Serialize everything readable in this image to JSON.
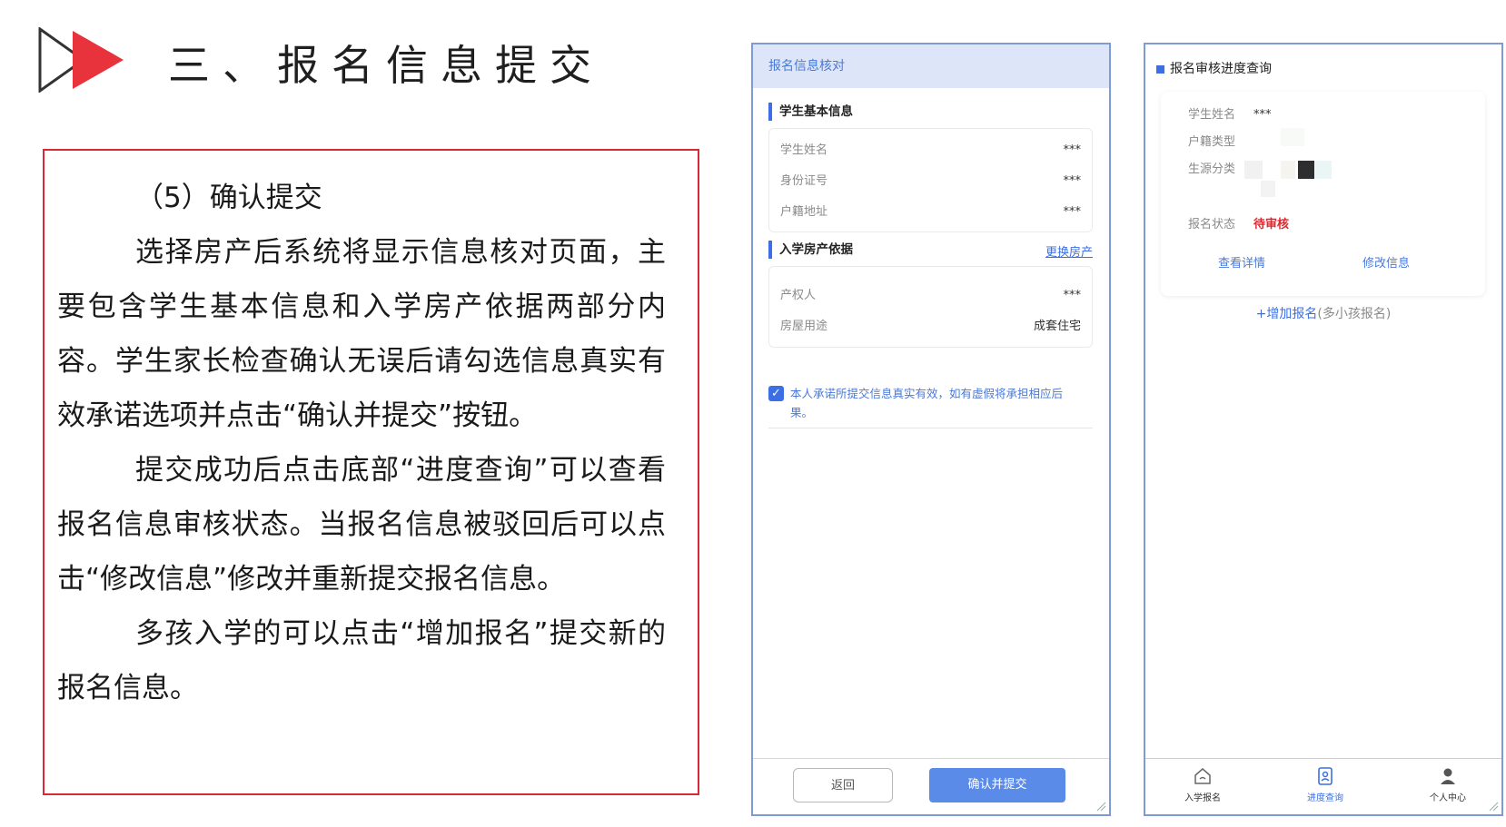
{
  "title": {
    "text": "三、报名信息提交"
  },
  "instructions": {
    "step": "（5）确认提交",
    "paragraphs": [
      "选择房产后系统将显示信息核对页面，主要包含学生基本信息和入学房产依据两部分内容。学生家长检查确认无误后请勾选信息真实有效承诺选项并点击“确认并提交”按钮。",
      "提交成功后点击底部“进度查询”可以查看报名信息审核状态。当报名信息被驳回后可以点击“修改信息”修改并重新提交报名信息。",
      "多孩入学的可以点击“增加报名”提交新的报名信息。"
    ]
  },
  "verify_screen": {
    "header": "报名信息核对",
    "student_section": {
      "title": "学生基本信息",
      "rows": [
        {
          "label": "学生姓名",
          "value": "***"
        },
        {
          "label": "身份证号",
          "value": "***"
        },
        {
          "label": "户籍地址",
          "value": "***"
        }
      ]
    },
    "property_section": {
      "title": "入学房产依据",
      "change_link": "更换房产",
      "rows": [
        {
          "label": "产权人",
          "value": "***"
        },
        {
          "label": "房屋用途",
          "value": "成套住宅"
        }
      ]
    },
    "pledge": {
      "checked": true,
      "text": "本人承诺所提交信息真实有效，如有虚假将承担相应后果。"
    },
    "back_button": "返回",
    "submit_button": "确认并提交"
  },
  "progress_screen": {
    "header": "报名审核进度查询",
    "fields": [
      {
        "label": "学生姓名",
        "value": "***"
      },
      {
        "label": "户籍类型",
        "value": ""
      },
      {
        "label": "生源分类",
        "value": ""
      },
      {
        "label": "报名状态",
        "value": "待审核"
      }
    ],
    "view_details": "查看详情",
    "modify_info": "修改信息",
    "add_registration": "+增加报名",
    "add_registration_note": "(多小孩报名)",
    "nav": [
      {
        "label": "入学报名",
        "icon": "home-icon",
        "active": false
      },
      {
        "label": "进度查询",
        "icon": "progress-doc-icon",
        "active": true
      },
      {
        "label": "个人中心",
        "icon": "user-icon",
        "active": false
      }
    ]
  },
  "colors": {
    "accent": "#3b6fe3",
    "frame": "#d9283a",
    "status_red": "#e0262f",
    "header_bg": "#dce6f8"
  }
}
